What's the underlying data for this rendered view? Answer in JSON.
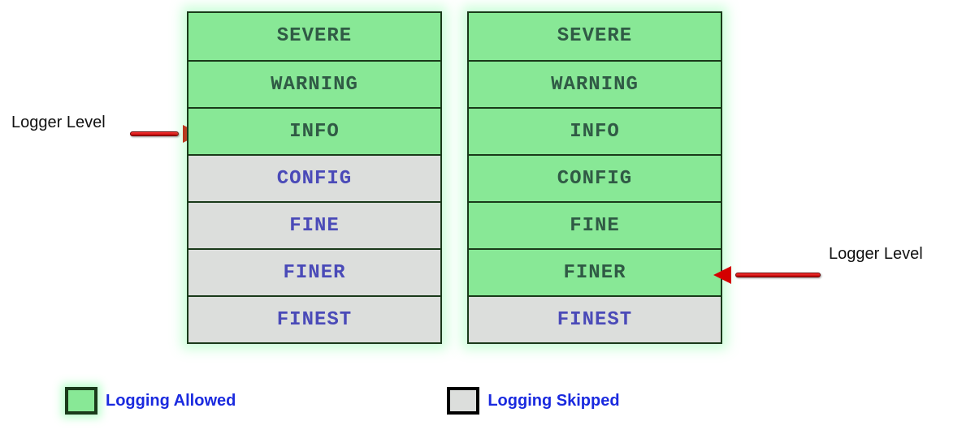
{
  "levels": {
    "severe": "SEVERE",
    "warning": "WARNING",
    "info": "INFO",
    "config": "CONFIG",
    "fine": "FINE",
    "finer": "FINER",
    "finest": "FINEST"
  },
  "pointer_label_left": "Logger Level",
  "pointer_label_right": "Logger Level",
  "legend": {
    "allowed": "Logging Allowed",
    "skipped": "Logging Skipped"
  },
  "chart_data": {
    "type": "table",
    "description": "Two stacked log-level tables showing which levels are logged (green) vs skipped (grey) for a given Logger Level threshold.",
    "levels_order": [
      "SEVERE",
      "WARNING",
      "INFO",
      "CONFIG",
      "FINE",
      "FINER",
      "FINEST"
    ],
    "columns": [
      {
        "logger_level": "INFO",
        "allowed": [
          "SEVERE",
          "WARNING",
          "INFO"
        ],
        "skipped": [
          "CONFIG",
          "FINE",
          "FINER",
          "FINEST"
        ]
      },
      {
        "logger_level": "FINER",
        "allowed": [
          "SEVERE",
          "WARNING",
          "INFO",
          "CONFIG",
          "FINE",
          "FINER"
        ],
        "skipped": [
          "FINEST"
        ]
      }
    ],
    "legend": {
      "allowed_color": "#88e896",
      "skipped_color": "#dcdedc"
    }
  }
}
